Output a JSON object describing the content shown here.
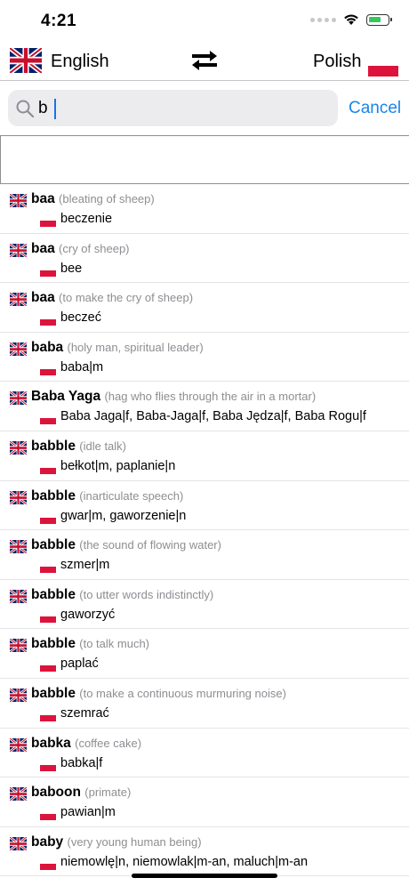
{
  "status": {
    "time": "4:21"
  },
  "languages": {
    "source": "English",
    "target": "Polish"
  },
  "search": {
    "value": "b",
    "cancel_label": "Cancel"
  },
  "results": [
    {
      "word": "baa",
      "note": "(bleating of sheep)",
      "translation": "beczenie"
    },
    {
      "word": "baa",
      "note": "(cry of sheep)",
      "translation": "bee"
    },
    {
      "word": "baa",
      "note": "(to make the cry of sheep)",
      "translation": "beczeć"
    },
    {
      "word": "baba",
      "note": "(holy man, spiritual leader)",
      "translation": "baba|m"
    },
    {
      "word": "Baba Yaga",
      "note": "(hag who flies through the air in a mortar)",
      "translation": "Baba Jaga|f, Baba-Jaga|f, Baba Jędza|f, Baba Rogu|f"
    },
    {
      "word": "babble",
      "note": "(idle talk)",
      "translation": "bełkot|m, paplanie|n"
    },
    {
      "word": "babble",
      "note": "(inarticulate speech)",
      "translation": "gwar|m, gaworzenie|n"
    },
    {
      "word": "babble",
      "note": "(the sound of flowing water)",
      "translation": "szmer|m"
    },
    {
      "word": "babble",
      "note": "(to utter words indistinctly)",
      "translation": "gaworzyć"
    },
    {
      "word": "babble",
      "note": "(to talk much)",
      "translation": "paplać"
    },
    {
      "word": "babble",
      "note": "(to make a continuous murmuring noise)",
      "translation": "szemrać"
    },
    {
      "word": "babka",
      "note": "(coffee cake)",
      "translation": "babka|f"
    },
    {
      "word": "baboon",
      "note": "(primate)",
      "translation": "pawian|m"
    },
    {
      "word": "baby",
      "note": "(very young human being)",
      "translation": "niemowlę|n, niemowlak|m-an, maluch|m-an"
    }
  ],
  "colors": {
    "accent": "#1a84e8",
    "pl_red": "#dc143c",
    "uk_blue": "#012169",
    "uk_red": "#c8102e"
  }
}
